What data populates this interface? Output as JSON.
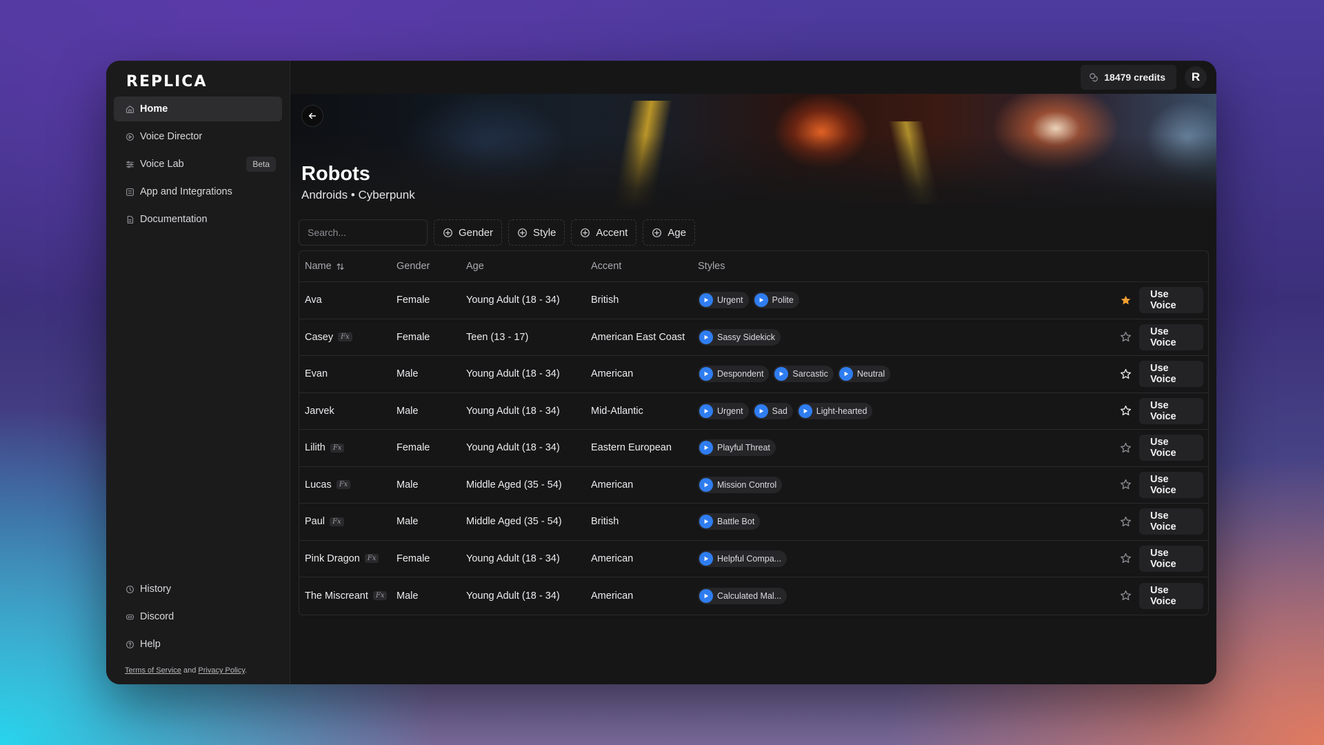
{
  "app": {
    "logo": "REPLICA"
  },
  "sidebar": {
    "items": [
      {
        "label": "Home",
        "icon": "home-icon"
      },
      {
        "label": "Voice Director",
        "icon": "director-icon"
      },
      {
        "label": "Voice Lab",
        "icon": "sliders-icon",
        "badge": "Beta"
      },
      {
        "label": "App and Integrations",
        "icon": "app-icon"
      },
      {
        "label": "Documentation",
        "icon": "doc-icon"
      }
    ],
    "bottom_items": [
      {
        "label": "History",
        "icon": "history-icon"
      },
      {
        "label": "Discord",
        "icon": "discord-icon"
      },
      {
        "label": "Help",
        "icon": "help-icon"
      }
    ],
    "legal": {
      "terms": "Terms of Service",
      "and": "and",
      "privacy": "Privacy Policy",
      "period": "."
    }
  },
  "topbar": {
    "credits": "18479 credits",
    "avatar_initial": "R"
  },
  "banner": {
    "title": "Robots",
    "subtitle": "Androids • Cyberpunk"
  },
  "filters": {
    "search_placeholder": "Search...",
    "buttons": [
      "Gender",
      "Style",
      "Accent",
      "Age"
    ]
  },
  "table": {
    "columns": [
      "Name",
      "Gender",
      "Age",
      "Accent",
      "Styles"
    ],
    "action_label": "Use Voice",
    "rows": [
      {
        "name": "Ava",
        "fx": false,
        "gender": "Female",
        "age": "Young Adult (18 - 34)",
        "accent": "British",
        "styles": [
          "Urgent",
          "Polite"
        ],
        "starred": "filled-orange"
      },
      {
        "name": "Casey",
        "fx": true,
        "gender": "Female",
        "age": "Teen (13 - 17)",
        "accent": "American East Coast",
        "styles": [
          "Sassy Sidekick"
        ],
        "starred": "outline-dim"
      },
      {
        "name": "Evan",
        "fx": false,
        "gender": "Male",
        "age": "Young Adult (18 - 34)",
        "accent": "American",
        "styles": [
          "Despondent",
          "Sarcastic",
          "Neutral"
        ],
        "starred": "outline-bright"
      },
      {
        "name": "Jarvek",
        "fx": false,
        "gender": "Male",
        "age": "Young Adult (18 - 34)",
        "accent": "Mid-Atlantic",
        "styles": [
          "Urgent",
          "Sad",
          "Light-hearted"
        ],
        "starred": "outline-bright"
      },
      {
        "name": "Lilith",
        "fx": true,
        "gender": "Female",
        "age": "Young Adult (18 - 34)",
        "accent": "Eastern European",
        "styles": [
          "Playful Threat"
        ],
        "starred": "outline-dim"
      },
      {
        "name": "Lucas",
        "fx": true,
        "gender": "Male",
        "age": "Middle Aged (35 - 54)",
        "accent": "American",
        "styles": [
          "Mission Control"
        ],
        "starred": "outline-dim"
      },
      {
        "name": "Paul",
        "fx": true,
        "gender": "Male",
        "age": "Middle Aged (35 - 54)",
        "accent": "British",
        "styles": [
          "Battle Bot"
        ],
        "starred": "outline-dim"
      },
      {
        "name": "Pink Dragon",
        "fx": true,
        "gender": "Female",
        "age": "Young Adult (18 - 34)",
        "accent": "American",
        "styles": [
          "Helpful Compa..."
        ],
        "starred": "outline-dim"
      },
      {
        "name": "The Miscreant",
        "fx": true,
        "gender": "Male",
        "age": "Young Adult (18 - 34)",
        "accent": "American",
        "styles": [
          "Calculated Mal..."
        ],
        "starred": "outline-dim"
      }
    ],
    "fx_label": "Fx"
  },
  "colors": {
    "accent_blue": "#2f7df0",
    "star_orange": "#f0a030"
  }
}
